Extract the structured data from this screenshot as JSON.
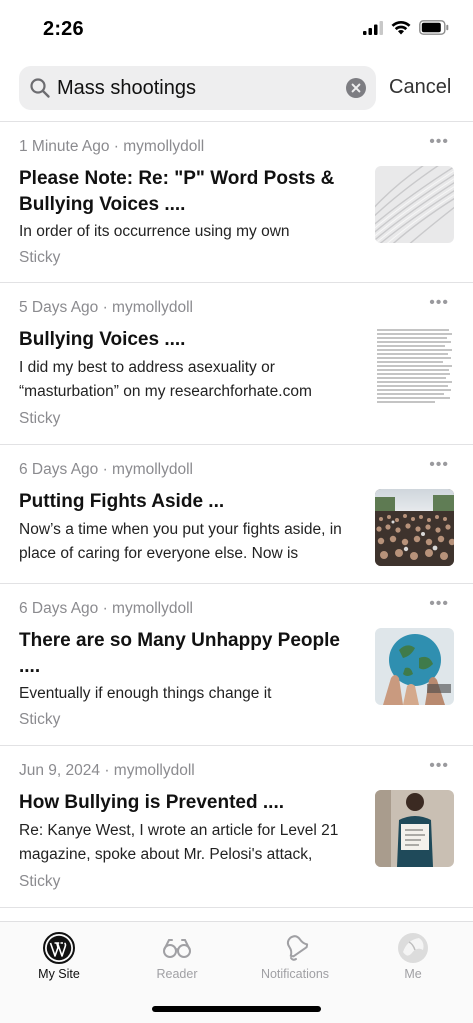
{
  "status_bar": {
    "time": "2:26"
  },
  "search": {
    "query": "Mass shootings",
    "cancel_label": "Cancel"
  },
  "posts": [
    {
      "meta": "1 Minute Ago · mymollydoll",
      "title": "Please Note: Re: \"P\" Word Posts & Bullying Voices ....",
      "excerpt": "In order of its occurrence using my own",
      "tag": "Sticky",
      "thumbnail": "abstract-white-architecture"
    },
    {
      "meta": "5 Days Ago · mymollydoll",
      "title": "Bullying Voices ....",
      "excerpt": "I did my best to address asexuality or “masturbation” on my researchforhate.com",
      "tag": "Sticky",
      "thumbnail": "text-document"
    },
    {
      "meta": "6 Days Ago · mymollydoll",
      "title": "Putting Fights Aside ...",
      "excerpt": "Now’s a time when you put your fights aside, in place of caring for everyone else. Now is",
      "tag": "",
      "thumbnail": "crowd-photo"
    },
    {
      "meta": "6 Days Ago · mymollydoll",
      "title": "There are so Many Unhappy People ....",
      "excerpt": "Eventually if enough things change it",
      "tag": "Sticky",
      "thumbnail": "hands-holding-globe"
    },
    {
      "meta": "Jun 9, 2024 · mymollydoll",
      "title": "How Bullying is Prevented ....",
      "excerpt": "Re: Kanye West, I wrote an article for Level 21 magazine, spoke about Mr. Pelosi's attack,",
      "tag": "Sticky",
      "thumbnail": "person-holding-sign"
    }
  ],
  "tabs": [
    {
      "label": "My Site",
      "icon": "wordpress-icon",
      "active": true
    },
    {
      "label": "Reader",
      "icon": "glasses-icon",
      "active": false
    },
    {
      "label": "Notifications",
      "icon": "bell-icon",
      "active": false
    },
    {
      "label": "Me",
      "icon": "avatar",
      "active": false
    }
  ]
}
